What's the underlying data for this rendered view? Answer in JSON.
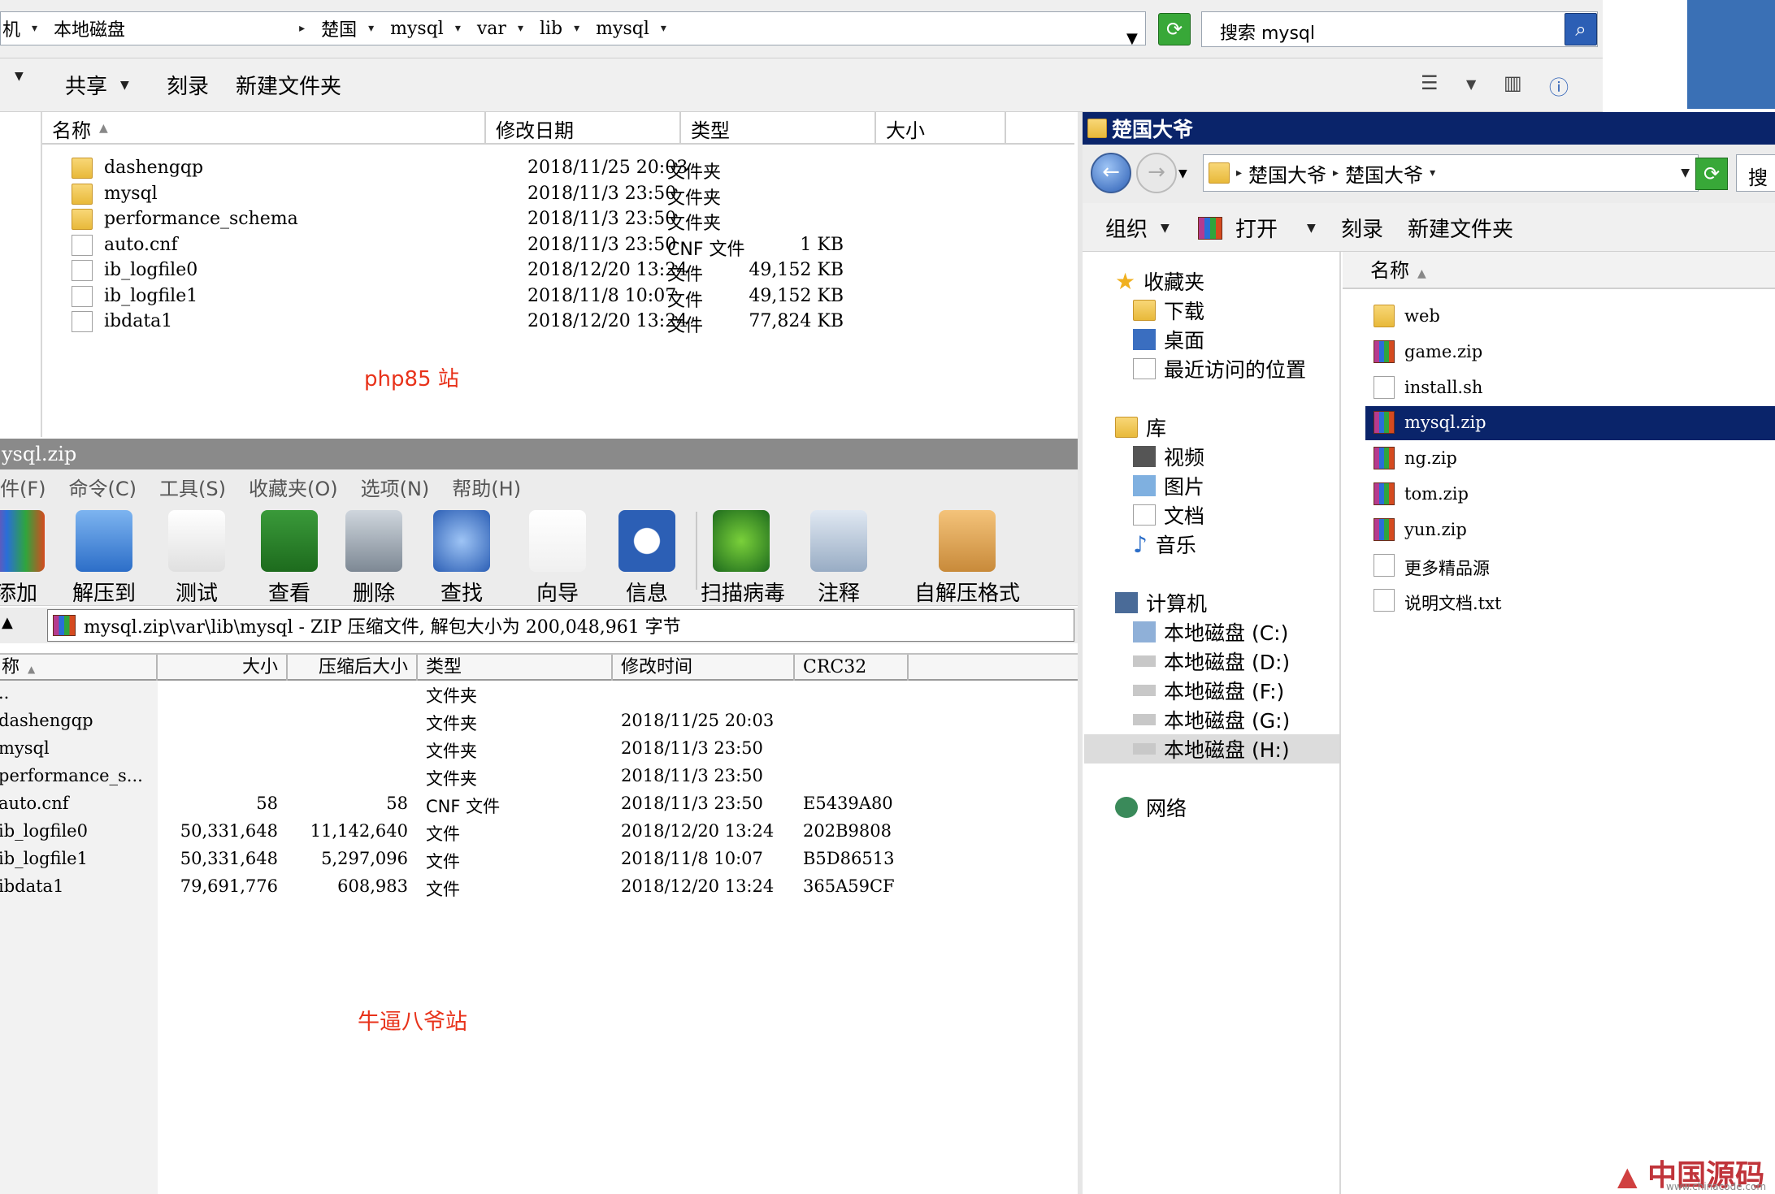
{
  "explorer1": {
    "breadcrumb": [
      "机",
      "本地磁盘",
      "楚国",
      "mysql",
      "var",
      "lib",
      "mysql"
    ],
    "search_placeholder": "搜索 mysql",
    "toolbar": {
      "share": "共享",
      "burn": "刻录",
      "new_folder": "新建文件夹"
    },
    "columns": {
      "name": "名称",
      "date": "修改日期",
      "type": "类型",
      "size": "大小"
    },
    "files": [
      {
        "name": "dashengqp",
        "date": "2018/11/25 20:03",
        "type": "文件夹",
        "size": "",
        "icon": "folder"
      },
      {
        "name": "mysql",
        "date": "2018/11/3 23:50",
        "type": "文件夹",
        "size": "",
        "icon": "folder"
      },
      {
        "name": "performance_schema",
        "date": "2018/11/3 23:50",
        "type": "文件夹",
        "size": "",
        "icon": "folder"
      },
      {
        "name": "auto.cnf",
        "date": "2018/11/3 23:50",
        "type": "CNF 文件",
        "size": "1 KB",
        "icon": "doc"
      },
      {
        "name": "ib_logfile0",
        "date": "2018/12/20 13:24",
        "type": "文件",
        "size": "49,152 KB",
        "icon": "doc"
      },
      {
        "name": "ib_logfile1",
        "date": "2018/11/8 10:07",
        "type": "文件",
        "size": "49,152 KB",
        "icon": "doc"
      },
      {
        "name": "ibdata1",
        "date": "2018/12/20 13:24",
        "type": "文件",
        "size": "77,824 KB",
        "icon": "doc"
      }
    ],
    "annotation": "php85 站"
  },
  "winrar": {
    "title": "ysql.zip",
    "menu": [
      "件(F)",
      "命令(C)",
      "工具(S)",
      "收藏夹(O)",
      "选项(N)",
      "帮助(H)"
    ],
    "tools": [
      "添加",
      "解压到",
      "测试",
      "查看",
      "删除",
      "查找",
      "向导",
      "信息",
      "扫描病毒",
      "注释",
      "自解压格式"
    ],
    "path": "mysql.zip\\var\\lib\\mysql - ZIP 压缩文件, 解包大小为 200,048,961 字节",
    "columns": [
      "称",
      "大小",
      "压缩后大小",
      "类型",
      "修改时间",
      "CRC32"
    ],
    "rows": [
      {
        "name": "..",
        "size": "",
        "packed": "",
        "type": "文件夹",
        "date": "",
        "crc": ""
      },
      {
        "name": "dashengqp",
        "size": "",
        "packed": "",
        "type": "文件夹",
        "date": "2018/11/25 20:03",
        "crc": ""
      },
      {
        "name": "mysql",
        "size": "",
        "packed": "",
        "type": "文件夹",
        "date": "2018/11/3 23:50",
        "crc": ""
      },
      {
        "name": "performance_s...",
        "size": "",
        "packed": "",
        "type": "文件夹",
        "date": "2018/11/3 23:50",
        "crc": ""
      },
      {
        "name": "auto.cnf",
        "size": "58",
        "packed": "58",
        "type": "CNF 文件",
        "date": "2018/11/3 23:50",
        "crc": "E5439A80"
      },
      {
        "name": "ib_logfile0",
        "size": "50,331,648",
        "packed": "11,142,640",
        "type": "文件",
        "date": "2018/12/20 13:24",
        "crc": "202B9808"
      },
      {
        "name": "ib_logfile1",
        "size": "50,331,648",
        "packed": "5,297,096",
        "type": "文件",
        "date": "2018/11/8 10:07",
        "crc": "B5D86513"
      },
      {
        "name": "ibdata1",
        "size": "79,691,776",
        "packed": "608,983",
        "type": "文件",
        "date": "2018/12/20 13:24",
        "crc": "365A59CF"
      }
    ],
    "annotation": "牛逼八爷站"
  },
  "explorer2": {
    "title": "楚国大爷",
    "breadcrumb": [
      "楚国大爷",
      "楚国大爷"
    ],
    "search_label": "搜",
    "toolbar": {
      "organize": "组织",
      "open": "打开",
      "burn": "刻录",
      "new_folder": "新建文件夹"
    },
    "nav": {
      "favorites": "收藏夹",
      "favorites_items": [
        "下载",
        "桌面",
        "最近访问的位置"
      ],
      "libraries": "库",
      "library_items": [
        "视频",
        "图片",
        "文档",
        "音乐"
      ],
      "computer": "计算机",
      "drives": [
        "本地磁盘 (C:)",
        "本地磁盘 (D:)",
        "本地磁盘 (F:)",
        "本地磁盘 (G:)",
        "本地磁盘 (H:)"
      ],
      "network": "网络"
    },
    "column_name": "名称",
    "files": [
      {
        "name": "web",
        "icon": "folder"
      },
      {
        "name": "game.zip",
        "icon": "zip"
      },
      {
        "name": "install.sh",
        "icon": "doc"
      },
      {
        "name": "mysql.zip",
        "icon": "zip"
      },
      {
        "name": "ng.zip",
        "icon": "zip"
      },
      {
        "name": "tom.zip",
        "icon": "zip"
      },
      {
        "name": "yun.zip",
        "icon": "zip"
      },
      {
        "name": "更多精品源",
        "icon": "doc"
      },
      {
        "name": "说明文档.txt",
        "icon": "doc"
      }
    ],
    "selected_file": "mysql.zip",
    "selected_drive": "本地磁盘 (H:)"
  },
  "watermark": {
    "text": "中国源码",
    "url": "www.chinacode.com"
  }
}
